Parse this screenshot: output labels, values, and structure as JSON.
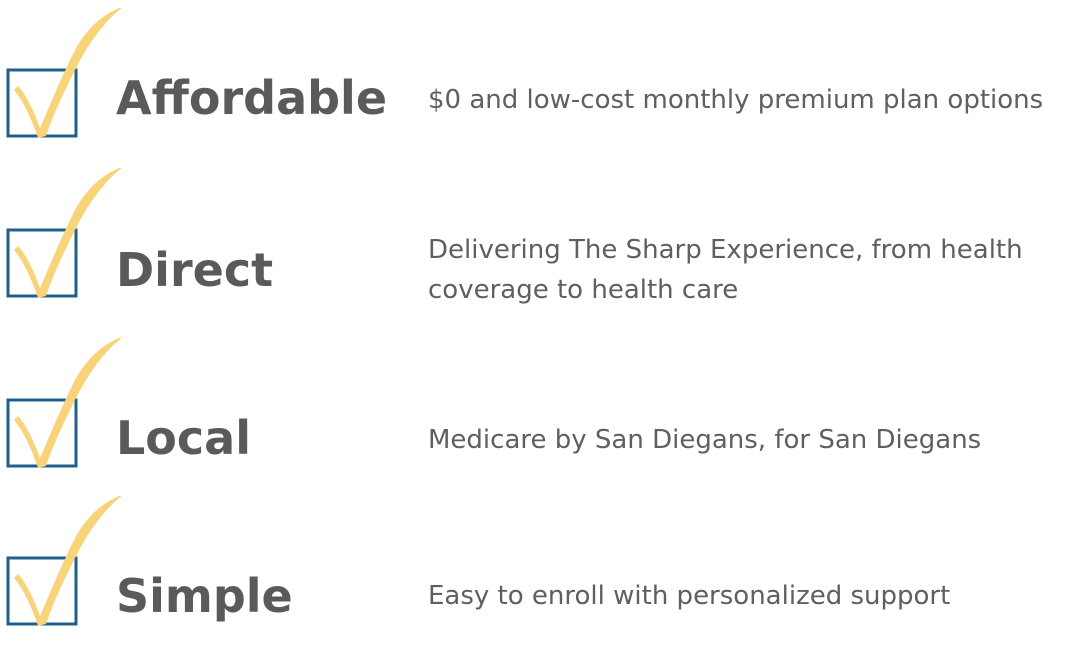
{
  "colors": {
    "box_stroke": "#1f5f8b",
    "check_fill": "#f9d37a",
    "heading_text": "#5a5a5a",
    "desc_text": "#5f5f5f"
  },
  "features": [
    {
      "icon": "checkbox-checked-icon",
      "title": "Affordable",
      "description": "$0 and low-cost monthly premium plan options"
    },
    {
      "icon": "checkbox-checked-icon",
      "title": "Direct",
      "description": "Delivering The Sharp Experience, from health coverage to health care"
    },
    {
      "icon": "checkbox-checked-icon",
      "title": "Local",
      "description": "Medicare by San Diegans, for San Diegans"
    },
    {
      "icon": "checkbox-checked-icon",
      "title": "Simple",
      "description": "Easy to enroll with personalized support"
    }
  ]
}
